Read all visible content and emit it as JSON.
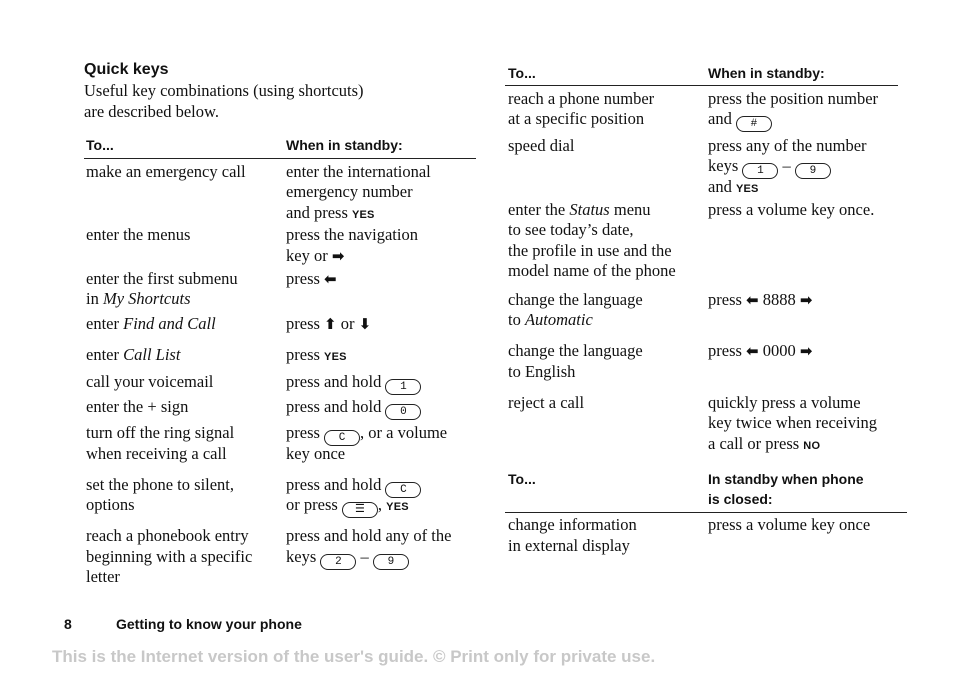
{
  "section": {
    "title": "Quick keys",
    "intro_line1": "Useful key combinations (using shortcuts)",
    "intro_line2": "are described below."
  },
  "table1": {
    "col1": "To...",
    "col2": "When in standby:"
  },
  "left_rows": {
    "r1": {
      "a": "make an emergency call",
      "b1": "enter the international",
      "b2": "emergency number",
      "b3": "and press ",
      "key": "YES"
    },
    "r2": {
      "a": "enter the menus",
      "b1": "press the navigation",
      "b2": "key or "
    },
    "r3": {
      "a1": "enter the first submenu",
      "a2pre": "in ",
      "a2it": "My Shortcuts",
      "b": "press "
    },
    "r4": {
      "apre": "enter ",
      "ait": "Find and Call",
      "b": "press ",
      "or": " or "
    },
    "r5": {
      "apre": "enter ",
      "ait": "Call List",
      "b": "press ",
      "key": "YES"
    },
    "r6": {
      "a": "call your voicemail",
      "b": "press and hold ",
      "key": "1"
    },
    "r7": {
      "a": "enter the + sign",
      "b": "press and hold ",
      "key": "0"
    },
    "r8": {
      "a1": "turn off the ring signal",
      "a2": "when receiving a call",
      "b1": "press ",
      "key": "C",
      "b1post": ", or a volume",
      "b2": "key once"
    },
    "r9": {
      "a1": "set the phone to silent,",
      "a2": "options",
      "b1": "press and hold ",
      "key1": "C",
      "b2": "or press ",
      "key2": "☰",
      "b2post": ", ",
      "yes": "YES"
    },
    "r10": {
      "a1": "reach a phonebook entry",
      "a2": "beginning with a specific",
      "a3": "letter",
      "b1": "press and hold any of the",
      "b2": "keys ",
      "key1": "2",
      "dash": " – ",
      "key2": "9"
    }
  },
  "table2": {
    "col1": "To...",
    "col2": "When in standby:"
  },
  "right_rows": {
    "r1": {
      "a1": "reach a phone number",
      "a2": "at a specific position",
      "b1": "press the position number",
      "b2": "and ",
      "key": "#"
    },
    "r2": {
      "a": "speed dial",
      "b1": "press any of the number",
      "b2": "keys ",
      "key1": "1",
      "dash": " – ",
      "key2": "9",
      "b3": "and ",
      "yes": "YES"
    },
    "r3": {
      "a1pre": "enter the ",
      "a1it": "Status",
      "a1post": " menu",
      "a2": "to see today’s date,",
      "a3": "the profile in use and the",
      "a4": "model name of the phone",
      "b": "press a volume key once."
    },
    "r4": {
      "a1": "change the language",
      "a2pre": "to ",
      "a2it": "Automatic",
      "b": "press ",
      "code": " 8888 "
    },
    "r5": {
      "a1": "change the language",
      "a2": "to English",
      "b": "press ",
      "code": " 0000 "
    },
    "r6": {
      "a": "reject a call",
      "b1": "quickly press a volume",
      "b2": "key twice when receiving",
      "b3": "a call or press ",
      "no": "NO"
    }
  },
  "table3": {
    "col1": "To...",
    "col2_line1": "In standby when phone",
    "col2_line2": "is closed:",
    "row": {
      "a1": "change information",
      "a2": "in external display",
      "b": "press a volume key once"
    }
  },
  "footer": {
    "page_number": "8",
    "chapter": "Getting to know your phone",
    "watermark": "This is the Internet version of the user's guide. © Print only for private use."
  },
  "icons": {
    "arrow_right": "➡",
    "arrow_left": "⬅",
    "arrow_up": "⬆",
    "arrow_down": "⬇"
  }
}
